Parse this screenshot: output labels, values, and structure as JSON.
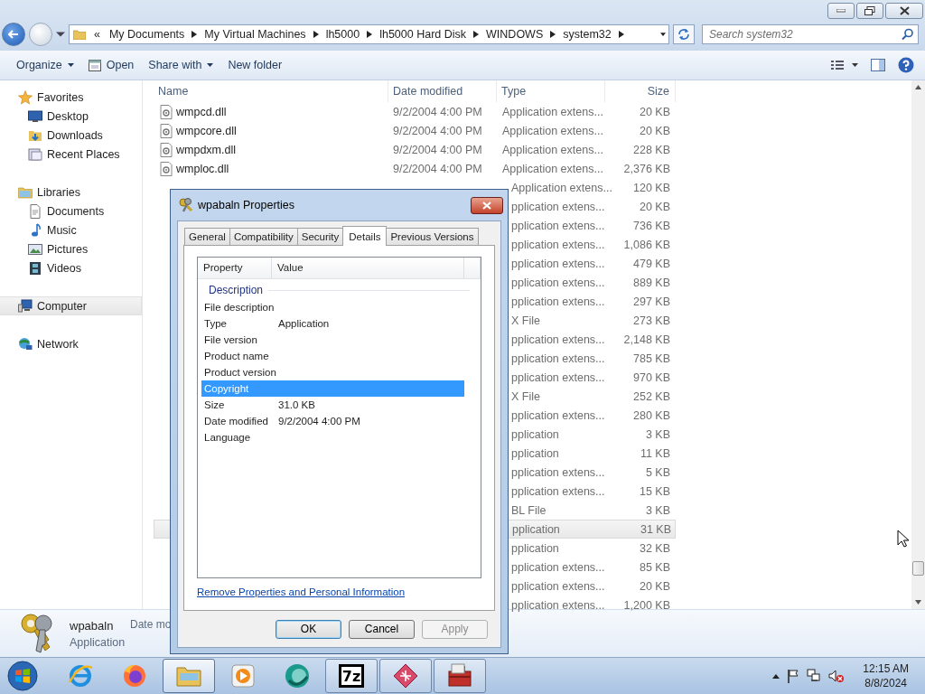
{
  "address_bar": {
    "overflow": "«",
    "path": [
      "My Documents",
      "My Virtual Machines",
      "lh5000",
      "lh5000 Hard Disk",
      "WINDOWS",
      "system32"
    ]
  },
  "search": {
    "placeholder": "Search system32"
  },
  "toolbar": [
    {
      "label": "Organize",
      "kind": "plain",
      "dropdown": true
    },
    {
      "label": "Open",
      "kind": "open",
      "dropdown": false
    },
    {
      "label": "Share with",
      "kind": "plain",
      "dropdown": true
    },
    {
      "label": "New folder",
      "kind": "plain",
      "dropdown": false
    }
  ],
  "sidebar": [
    {
      "label": "Favorites",
      "kind": "star",
      "selected": false,
      "children": [
        {
          "label": "Desktop",
          "kind": "desktop",
          "selected": false
        },
        {
          "label": "Downloads",
          "kind": "downloads",
          "selected": false
        },
        {
          "label": "Recent Places",
          "kind": "recent",
          "selected": false
        }
      ]
    },
    {
      "label": "Libraries",
      "kind": "library",
      "selected": false,
      "children": [
        {
          "label": "Documents",
          "kind": "document",
          "selected": false
        },
        {
          "label": "Music",
          "kind": "music",
          "selected": false
        },
        {
          "label": "Pictures",
          "kind": "pictures",
          "selected": false
        },
        {
          "label": "Videos",
          "kind": "videos",
          "selected": false
        }
      ]
    },
    {
      "label": "Computer",
      "kind": "computer",
      "selected": true
    },
    {
      "label": "Network",
      "kind": "network",
      "selected": false
    }
  ],
  "columns": [
    "Name",
    "Date modified",
    "Type",
    "Size"
  ],
  "rows": [
    {
      "name": "wmpcd.dll",
      "date": "9/2/2004 4:00 PM",
      "type": "Application extens...",
      "size": "20 KB",
      "selected": false
    },
    {
      "name": "wmpcore.dll",
      "date": "9/2/2004 4:00 PM",
      "type": "Application extens...",
      "size": "20 KB",
      "selected": false
    },
    {
      "name": "wmpdxm.dll",
      "date": "9/2/2004 4:00 PM",
      "type": "Application extens...",
      "size": "228 KB",
      "selected": false
    },
    {
      "name": "wmploc.dll",
      "date": "9/2/2004 4:00 PM",
      "type": "Application extens...",
      "size": "2,376 KB",
      "selected": false
    },
    {
      "type": "Application extens...",
      "size": "120 KB",
      "selected": false
    },
    {
      "type": "pplication extens...",
      "size": "20 KB",
      "selected": false
    },
    {
      "type": "pplication extens...",
      "size": "736 KB",
      "selected": false
    },
    {
      "type": "pplication extens...",
      "size": "1,086 KB",
      "selected": false
    },
    {
      "type": "pplication extens...",
      "size": "479 KB",
      "selected": false
    },
    {
      "type": "pplication extens...",
      "size": "889 KB",
      "selected": false
    },
    {
      "type": "pplication extens...",
      "size": "297 KB",
      "selected": false
    },
    {
      "type": "X File",
      "size": "273 KB",
      "selected": false
    },
    {
      "type": "pplication extens...",
      "size": "2,148 KB",
      "selected": false
    },
    {
      "type": "pplication extens...",
      "size": "785 KB",
      "selected": false
    },
    {
      "type": "pplication extens...",
      "size": "970 KB",
      "selected": false
    },
    {
      "type": "X File",
      "size": "252 KB",
      "selected": false
    },
    {
      "type": "pplication extens...",
      "size": "280 KB",
      "selected": false
    },
    {
      "type": "pplication",
      "size": "3 KB",
      "selected": false
    },
    {
      "type": "pplication",
      "size": "11 KB",
      "selected": false
    },
    {
      "type": "pplication extens...",
      "size": "5 KB",
      "selected": false
    },
    {
      "type": "pplication extens...",
      "size": "15 KB",
      "selected": false
    },
    {
      "type": "BL File",
      "size": "3 KB",
      "selected": false
    },
    {
      "type": "pplication",
      "size": "31 KB",
      "selected": true
    },
    {
      "type": "pplication",
      "size": "32 KB",
      "selected": false
    },
    {
      "type": "pplication extens...",
      "size": "85 KB",
      "selected": false
    },
    {
      "type": "pplication extens...",
      "size": "20 KB",
      "selected": false
    },
    {
      "type": "pplication extens...",
      "size": "1,200 KB",
      "selected": false
    }
  ],
  "details_pane": {
    "name": "wpabaln",
    "type": "Application",
    "label_3": "Date mo"
  },
  "dialog": {
    "title": "wpabaln Properties",
    "tabs": [
      {
        "label": "General",
        "selected": false
      },
      {
        "label": "Compatibility",
        "selected": false
      },
      {
        "label": "Security",
        "selected": false
      },
      {
        "label": "Details",
        "selected": true
      },
      {
        "label": "Previous Versions",
        "selected": false
      }
    ],
    "columns": [
      "Property",
      "Value"
    ],
    "group": "Description",
    "properties": [
      {
        "name": "File description",
        "selected": false
      },
      {
        "name": "Type",
        "value": "Application",
        "selected": false
      },
      {
        "name": "File version",
        "selected": false
      },
      {
        "name": "Product name",
        "selected": false
      },
      {
        "name": "Product version",
        "selected": false
      },
      {
        "name": "Copyright",
        "selected": true
      },
      {
        "name": "Size",
        "value": "31.0 KB",
        "selected": false
      },
      {
        "name": "Date modified",
        "value": "9/2/2004 4:00 PM",
        "selected": false
      },
      {
        "name": "Language",
        "selected": false
      }
    ],
    "link": "Remove Properties and Personal Information",
    "buttons": [
      {
        "label": "OK",
        "default": true,
        "disabled": false
      },
      {
        "label": "Cancel",
        "default": false,
        "disabled": false
      },
      {
        "label": "Apply",
        "default": false,
        "disabled": true
      }
    ]
  },
  "taskbar": {
    "apps": [
      {
        "kind": "ie",
        "active": false
      },
      {
        "kind": "firefox",
        "active": false
      },
      {
        "kind": "explorer",
        "active": true
      },
      {
        "kind": "media",
        "active": false
      },
      {
        "kind": "globe",
        "active": false
      },
      {
        "kind": "sevenzip",
        "label": "7z",
        "active": false
      },
      {
        "kind": "diamond",
        "active": false
      },
      {
        "kind": "toolbox",
        "active": false
      }
    ],
    "clock": {
      "time": "12:15 AM",
      "date": "8/8/2024"
    }
  }
}
